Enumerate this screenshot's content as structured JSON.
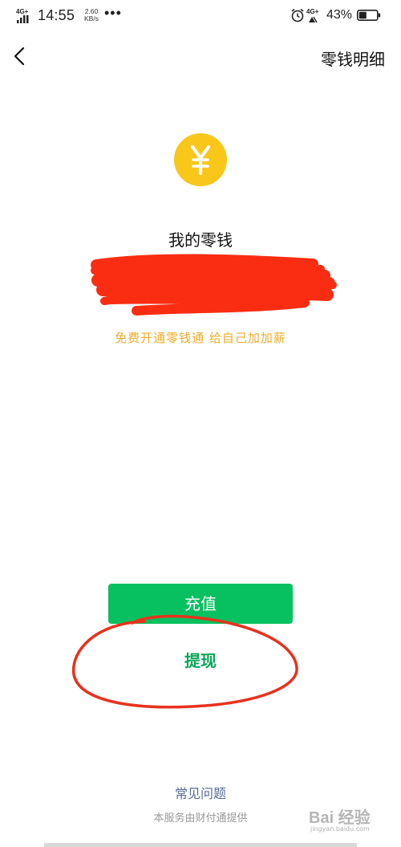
{
  "status_bar": {
    "network_left": "4G+",
    "time": "14:55",
    "speed_value": "2.60",
    "speed_unit": "KB/s",
    "more": "•••",
    "network_right": "4G+",
    "battery_percent": "43%",
    "battery_level": 0.43
  },
  "nav": {
    "back_icon": "chevron-left-icon",
    "detail_label": "零钱明细"
  },
  "wallet": {
    "coin_icon": "yuan-icon",
    "coin_color": "#f9c61a",
    "title": "我的零钱",
    "promo": "免费开通零钱通 给自己加加薪"
  },
  "actions": {
    "recharge_label": "充值",
    "withdraw_label": "提现",
    "accent_color": "#07c160"
  },
  "footer": {
    "faq_label": "常见问题",
    "service_note": "本服务由财付通提供"
  },
  "watermark": {
    "text": "Bai 经验",
    "sub": "jingyan.baidu.com"
  }
}
